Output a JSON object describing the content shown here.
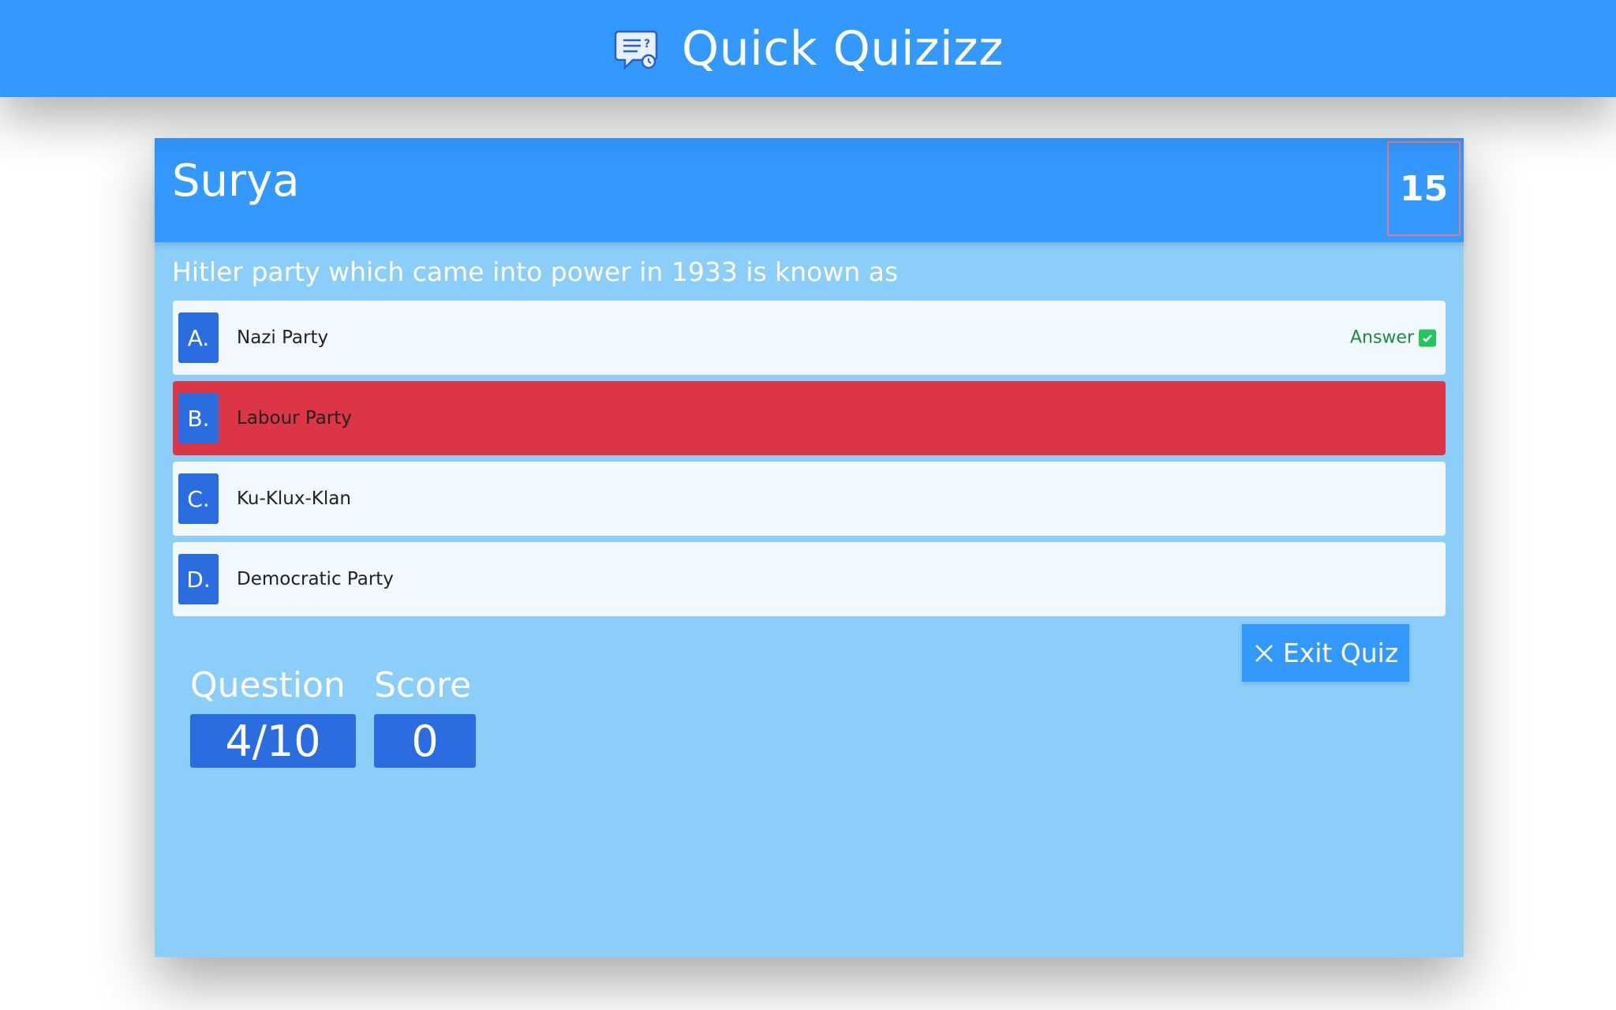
{
  "app": {
    "title": "Quick Quizizz",
    "icon": "quiz-chat-icon"
  },
  "quiz": {
    "player_name": "Surya",
    "timer": "15",
    "question": "Hitler party which came into power in 1933 is known as",
    "options": [
      {
        "letter": "A.",
        "text": "Nazi Party",
        "state": "correct"
      },
      {
        "letter": "B.",
        "text": "Labour Party",
        "state": "wrong"
      },
      {
        "letter": "C.",
        "text": "Ku-Klux-Klan",
        "state": "default"
      },
      {
        "letter": "D.",
        "text": "Democratic Party",
        "state": "default"
      }
    ],
    "answer_label": "Answer",
    "exit_label": "Exit Quiz",
    "question_label": "Question",
    "question_value": "4/10",
    "score_label": "Score",
    "score_value": "0"
  },
  "colors": {
    "header_blue": "#3399ff",
    "card_bg": "#8acef9",
    "option_bg": "#f1f8fe",
    "wrong_red": "#dc3545",
    "letter_blue": "#2b6de0",
    "correct_green": "#22c55e"
  }
}
